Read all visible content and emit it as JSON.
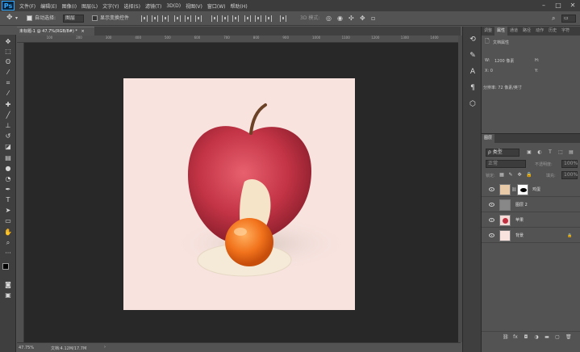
{
  "menu": {
    "logo": "Ps",
    "items": [
      "文件(F)",
      "编辑(E)",
      "图像(I)",
      "图层(L)",
      "文字(Y)",
      "选择(S)",
      "滤镜(T)",
      "3D(D)",
      "视图(V)",
      "窗口(W)",
      "帮助(H)"
    ]
  },
  "options": {
    "auto_select_label": "自动选择:",
    "auto_select_value": "图层",
    "show_transform_label": "显示变换控件",
    "mode_3d_label": "3D 模式:"
  },
  "document": {
    "tab_title": "未标题-1 @ 47.7%(RGB/8#) *",
    "ruler_marks": [
      "",
      "100",
      "200",
      "300",
      "400",
      "500",
      "600",
      "700",
      "800",
      "900",
      "1000",
      "1100",
      "1200",
      "1300",
      "1400"
    ]
  },
  "status": {
    "zoom": "47.75%",
    "doc_size": "文档:4.12M/17.7M"
  },
  "properties": {
    "tabs": [
      "调整",
      "属性",
      "通道",
      "路径",
      "动作",
      "历史",
      "字符"
    ],
    "active_tab": 1,
    "section_title": "文档属性",
    "w_label": "W:",
    "w_value": "1200 像素",
    "h_label": "H:",
    "x_label": "X: 0",
    "y_label": "Y:",
    "resolution": "分辨率: 72 像素/英寸"
  },
  "layers_panel": {
    "tab": "图层",
    "filter_kind": "ρ 类型",
    "blend_mode": "正常",
    "opacity_label": "不透明度:",
    "opacity_value": "100%",
    "lock_label": "锁定:",
    "fill_label": "填充:",
    "fill_value": "100%",
    "layers": [
      {
        "name": "鸡蛋",
        "has_mask": true,
        "thumb_color": "#e8caa8"
      },
      {
        "name": "图层 2",
        "has_mask": false,
        "thumb_color": "#888888"
      },
      {
        "name": "苹果",
        "has_mask": false,
        "thumb_color": "#c03040"
      },
      {
        "name": "背景",
        "has_mask": false,
        "thumb_color": "#f8e3df",
        "locked": true
      }
    ]
  },
  "colors": {
    "canvas_bg": "#f8e3df",
    "app_bg": "#535353",
    "pasteboard": "#282828",
    "accent": "#31a8ff"
  }
}
